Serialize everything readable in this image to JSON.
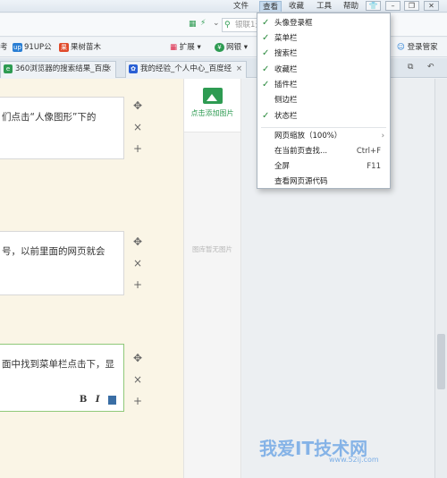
{
  "menubar": {
    "items": [
      "文件",
      "查看",
      "收藏",
      "工具",
      "帮助"
    ],
    "active": "查看"
  },
  "addressbar": {
    "search_placeholder": "银联1元"
  },
  "bookmarks": [
    {
      "label": "考",
      "badge": ""
    },
    {
      "label": "91UP公",
      "badge": "up"
    },
    {
      "label": "果树苗木",
      "badge": "果"
    },
    {
      "label": "扩展",
      "badge": ""
    },
    {
      "label": "网银",
      "badge": "¥"
    },
    {
      "label": "登录管家",
      "badge": ""
    }
  ],
  "tabs": [
    {
      "label": "360浏览器的搜索结果_百度",
      "close": "×"
    },
    {
      "label": "我的经验_个人中心_百度经",
      "close": "×"
    }
  ],
  "cards": [
    {
      "text": "们点击“人像图形”下的"
    },
    {
      "text": "号，以前里面的网页就会"
    },
    {
      "text": "面中找到菜单栏点击下，显",
      "format": [
        "B",
        "I"
      ]
    }
  ],
  "tools": {
    "move": "✥",
    "delete": "×",
    "add": "+"
  },
  "image_panel": {
    "add_label": "点击添加图片",
    "empty_label": "图库暂无图片"
  },
  "dropdown": {
    "toggles": [
      {
        "label": "头像登录框",
        "checked": true
      },
      {
        "label": "菜单栏",
        "checked": true
      },
      {
        "label": "搜索栏",
        "checked": true
      },
      {
        "label": "收藏栏",
        "checked": true
      },
      {
        "label": "插件栏",
        "checked": true
      },
      {
        "label": "侧边栏",
        "checked": false
      },
      {
        "label": "状态栏",
        "checked": true
      }
    ],
    "actions": [
      {
        "label": "网页缩放（100%）",
        "shortcut": "›"
      },
      {
        "label": "在当前页查找...",
        "shortcut": "Ctrl+F"
      },
      {
        "label": "全屏",
        "shortcut": "F11"
      },
      {
        "label": "查看网页源代码",
        "shortcut": ""
      }
    ]
  },
  "watermark": {
    "text": "我爱IT技术网",
    "url": "www.52ij.com"
  },
  "colors": {
    "check": "#2b8a3e",
    "green_accent": "#2e9b52",
    "focus_border": "#8fc879"
  }
}
